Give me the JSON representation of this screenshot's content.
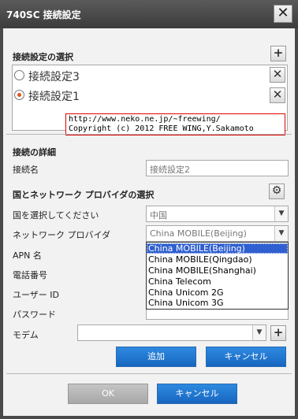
{
  "window": {
    "title": "740SC 接続設定",
    "close_icon": "close-icon"
  },
  "connection_select": {
    "heading": "接続設定の選択",
    "add_icon": "plus-icon",
    "items": [
      {
        "label": "接続設定3",
        "selected": false
      },
      {
        "label": "接続設定1",
        "selected": true
      }
    ],
    "copyright_line1": "http://www.neko.ne.jp/~freewing/",
    "copyright_line2": "Copyright (c) 2012 FREE WING,Y.Sakamoto"
  },
  "details": {
    "heading": "接続の詳細",
    "name_label": "接続名",
    "name_value": "接続設定2"
  },
  "provider": {
    "heading": "国とネットワーク プロバイダの選択",
    "settings_icon": "gear-icon",
    "country_label": "国を選択してください",
    "country_value": "中国",
    "network_label": "ネットワーク プロバイダ",
    "network_value": "China MOBILE(Beijing)",
    "network_options": [
      {
        "label": "China MOBILE(Beijing)",
        "selected": true
      },
      {
        "label": "China MOBILE(Qingdao)",
        "selected": false
      },
      {
        "label": "China MOBILE(Shanghai)",
        "selected": false
      },
      {
        "label": "China Telecom",
        "selected": false
      },
      {
        "label": "China Unicom 2G",
        "selected": false
      },
      {
        "label": "China Unicom 3G",
        "selected": false
      }
    ],
    "apn_label": "APN 名",
    "phone_label": "電話番号",
    "user_label": "ユーザー ID",
    "password_label": "パスワード",
    "modem_label": "モデム",
    "modem_value": ""
  },
  "buttons": {
    "add": "追加",
    "cancel_inner": "キャンセル",
    "ok": "OK",
    "cancel": "キャンセル"
  }
}
